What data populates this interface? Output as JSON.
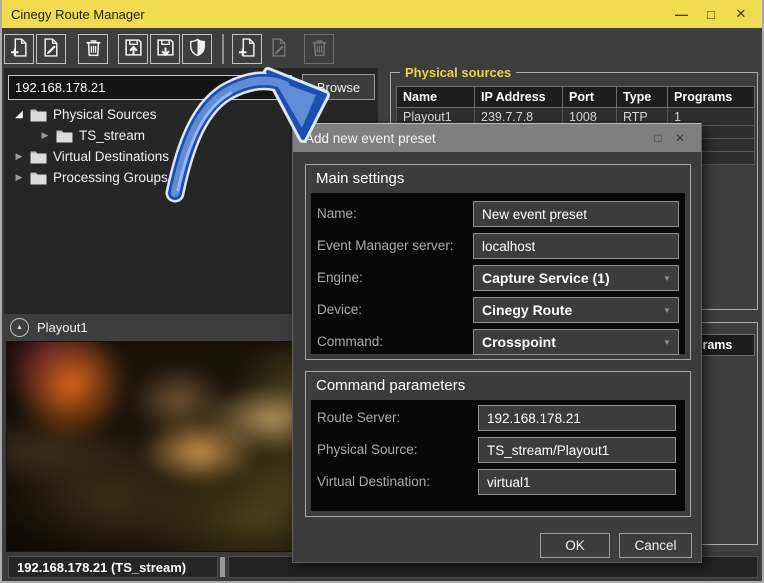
{
  "window": {
    "title": "Cinegy Route Manager"
  },
  "icons": {
    "minimize": "—",
    "maximize": "□",
    "close": "✕",
    "dialog_maximize": "□",
    "dialog_close": "✕",
    "combo_caret": "▼",
    "expander_up": "▲",
    "tree_expanded": "◢",
    "tree_collapsed": "▶"
  },
  "toolbar": {
    "buttons": [
      {
        "name": "new-preset",
        "enabled": true
      },
      {
        "name": "edit-preset",
        "enabled": true
      },
      {
        "name": "delete-preset",
        "enabled": true
      },
      {
        "name": "save-config-up",
        "enabled": true
      },
      {
        "name": "save-config-down",
        "enabled": true
      },
      {
        "name": "security-shield",
        "enabled": true
      },
      {
        "name": "new-item",
        "enabled": true
      },
      {
        "name": "edit-item",
        "enabled": false
      },
      {
        "name": "delete-item",
        "enabled": false
      }
    ]
  },
  "address_bar": {
    "value": "192.168.178.21",
    "browse_label": "Browse"
  },
  "tree": {
    "items": [
      {
        "label": "Physical Sources",
        "level": 0,
        "state": "expanded"
      },
      {
        "label": "TS_stream",
        "level": 1,
        "state": "collapsed"
      },
      {
        "label": "Virtual Destinations",
        "level": 0,
        "state": "collapsed"
      },
      {
        "label": "Processing Groups",
        "level": 0,
        "state": "collapsed"
      }
    ]
  },
  "physical_sources": {
    "label": "Physical sources",
    "columns": [
      "Name",
      "IP Address",
      "Port",
      "Type",
      "Programs"
    ],
    "rows": [
      [
        "Playout1",
        "239.7.7.8",
        "1008",
        "RTP",
        "1"
      ]
    ]
  },
  "second_group": {
    "visible_columns": [
      "",
      "",
      "",
      "",
      "Programs"
    ]
  },
  "preview": {
    "title": "Playout1"
  },
  "status_bar": {
    "text": "192.168.178.21 (TS_stream)"
  },
  "dialog": {
    "title": "Add new event preset",
    "main_settings": {
      "label": "Main settings",
      "fields": [
        {
          "label": "Name:",
          "value": "New event preset",
          "type": "text"
        },
        {
          "label": "Event Manager server:",
          "value": "localhost",
          "type": "text"
        },
        {
          "label": "Engine:",
          "value": "Capture Service (1)",
          "type": "combo"
        },
        {
          "label": "Device:",
          "value": "Cinegy Route",
          "type": "combo"
        },
        {
          "label": "Command:",
          "value": "Crosspoint",
          "type": "combo"
        }
      ]
    },
    "command_parameters": {
      "label": "Command parameters",
      "fields": [
        {
          "label": "Route Server:",
          "value": "192.168.178.21",
          "type": "text"
        },
        {
          "label": "Physical Source:",
          "value": "TS_stream/Playout1",
          "type": "text"
        },
        {
          "label": "Virtual Destination:",
          "value": "virtual1",
          "type": "text"
        }
      ]
    },
    "ok_label": "OK",
    "cancel_label": "Cancel"
  },
  "colors": {
    "titlebar": "#F0DC4E",
    "group_label": "#E5D24B",
    "arrow_fill": "#5E8CD9",
    "arrow_edge": "#1D4FAE",
    "arrow_glow": "#DDE6F6"
  }
}
